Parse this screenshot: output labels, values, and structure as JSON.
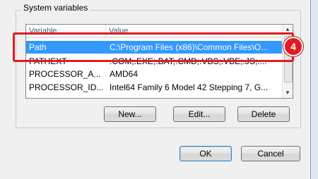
{
  "system_variables": {
    "group_label": "System variables",
    "columns": [
      "Variable",
      "Value"
    ],
    "rows": [
      {
        "variable": "Path",
        "value": "C:\\Program Files (x86)\\Common Files\\O...",
        "selected": true
      },
      {
        "variable": "PATHEXT",
        "value": ".COM;.EXE;.BAT;.CMD;.VBS;.VBE;.JS;....",
        "selected": false
      },
      {
        "variable": "PROCESSOR_A...",
        "value": "AMD64",
        "selected": false
      },
      {
        "variable": "PROCESSOR_ID...",
        "value": "Intel64 Family 6 Model 42 Stepping 7, G...",
        "selected": false
      }
    ],
    "buttons": {
      "new": "New...",
      "edit": "Edit...",
      "delete": "Delete"
    }
  },
  "dialog_buttons": {
    "ok": "OK",
    "cancel": "Cancel"
  },
  "annotation": {
    "step_number": "4",
    "highlight_color": "#e01b24"
  },
  "colors": {
    "selection": "#3399ff"
  }
}
